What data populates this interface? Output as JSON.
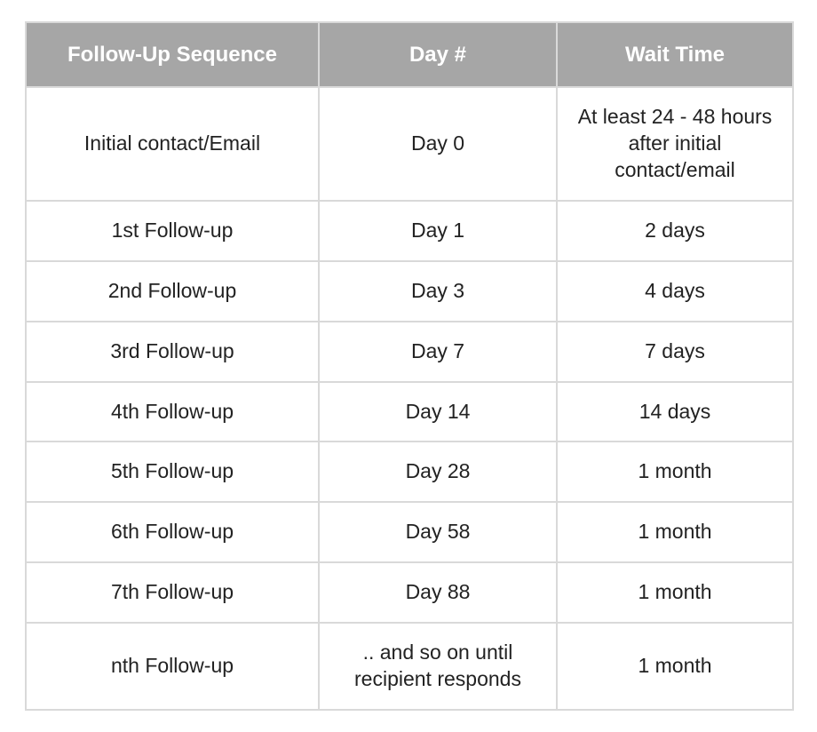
{
  "table": {
    "headers": {
      "sequence": "Follow-Up Sequence",
      "day": "Day #",
      "wait": "Wait Time"
    },
    "rows": [
      {
        "sequence": "Initial contact/Email",
        "day": "Day 0",
        "wait": "At least 24 - 48 hours after initial contact/email",
        "wait_align": "left"
      },
      {
        "sequence": "1st Follow-up",
        "day": "Day 1",
        "wait": "2 days"
      },
      {
        "sequence": "2nd Follow-up",
        "day": "Day 3",
        "wait": "4 days"
      },
      {
        "sequence": "3rd Follow-up",
        "day": "Day 7",
        "wait": "7 days"
      },
      {
        "sequence": "4th Follow-up",
        "day": "Day 14",
        "wait": "14 days"
      },
      {
        "sequence": "5th Follow-up",
        "day": "Day 28",
        "wait": "1 month"
      },
      {
        "sequence": "6th Follow-up",
        "day": "Day 58",
        "wait": "1 month"
      },
      {
        "sequence": "7th Follow-up",
        "day": "Day 88",
        "wait": "1 month"
      },
      {
        "sequence": "nth Follow-up",
        "day": ".. and so on until recipient responds",
        "wait": "1 month"
      }
    ]
  }
}
